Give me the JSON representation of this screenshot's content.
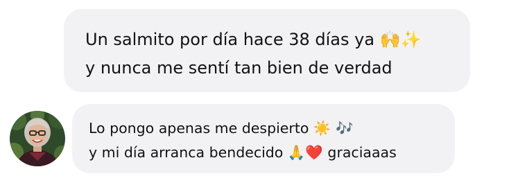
{
  "messages": [
    {
      "lines": [
        "Un salmito por día hace 38 días ya 🙌✨",
        "y nunca me sentí tan bien de verdad"
      ]
    },
    {
      "avatar": "woman-with-glasses-avatar",
      "lines": [
        "Lo pongo apenas me despierto ☀️ 🎶",
        "y mi día arranca bendecido 🙏❤️ graciaaas"
      ]
    }
  ]
}
